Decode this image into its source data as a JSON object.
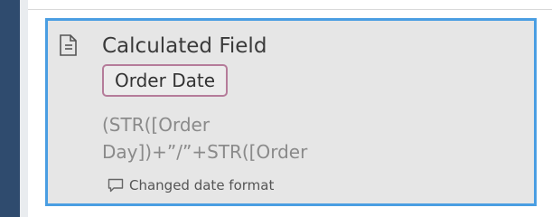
{
  "step": {
    "title": "Calculated Field",
    "field_chip": "Order Date",
    "formula_lines": [
      "(STR([Order",
      "Day])+”/”+STR([Order"
    ],
    "comment": "Changed date format"
  },
  "icons": {
    "step_icon": "calculated-field-doc-icon",
    "comment_icon": "comment-icon"
  },
  "colors": {
    "selection_border": "#4a9ee2",
    "chip_border": "#b57c9a",
    "left_bar": "#2f4b6e",
    "card_bg": "#e6e6e6"
  }
}
